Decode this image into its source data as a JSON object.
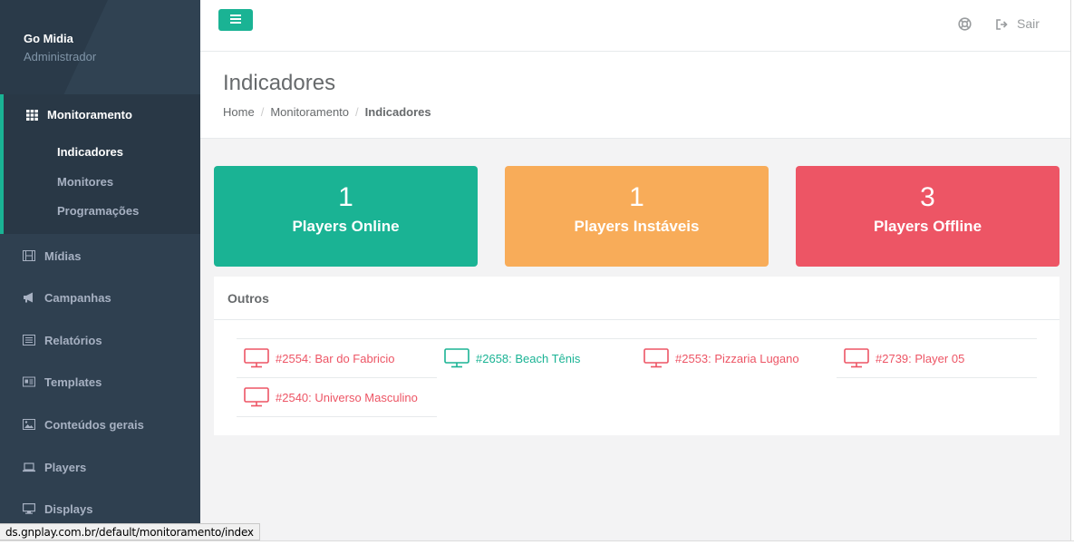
{
  "profile": {
    "name": "Go Midia",
    "role": "Administrador"
  },
  "sidebar": {
    "active_section": {
      "label": "Monitoramento",
      "icon": "grid-icon"
    },
    "sub_items": [
      {
        "label": "Indicadores",
        "active": true
      },
      {
        "label": "Monitores",
        "active": false
      },
      {
        "label": "Programações",
        "active": false
      }
    ],
    "items": [
      {
        "label": "Mídias",
        "icon": "film-icon"
      },
      {
        "label": "Campanhas",
        "icon": "bullhorn-icon"
      },
      {
        "label": "Relatórios",
        "icon": "list-alt-icon"
      },
      {
        "label": "Templates",
        "icon": "id-card-icon"
      },
      {
        "label": "Conteúdos gerais",
        "icon": "image-icon"
      },
      {
        "label": "Players",
        "icon": "laptop-icon"
      },
      {
        "label": "Displays",
        "icon": "desktop-icon"
      }
    ]
  },
  "topbar": {
    "menu_icon": "bars-icon",
    "help_icon": "life-ring-icon",
    "logout_label": "Sair",
    "logout_icon": "sign-out-icon"
  },
  "page": {
    "title": "Indicadores",
    "breadcrumb": [
      "Home",
      "Monitoramento",
      "Indicadores"
    ]
  },
  "widgets": [
    {
      "count": "1",
      "label": "Players Online",
      "color": "#1ab394"
    },
    {
      "count": "1",
      "label": "Players Instáveis",
      "color": "#f8ac59"
    },
    {
      "count": "3",
      "label": "Players Offline",
      "color": "#ed5565"
    }
  ],
  "panel": {
    "title": "Outros",
    "players": [
      {
        "label": "#2554: Bar do Fabricio",
        "status": "red"
      },
      {
        "label": "#2658: Beach Tênis",
        "status": "green"
      },
      {
        "label": "#2553: Pizzaria Lugano",
        "status": "red"
      },
      {
        "label": "#2739: Player 05",
        "status": "red"
      },
      {
        "label": "#2540: Universo Masculino",
        "status": "red"
      }
    ]
  },
  "statusbar": {
    "url": "ds.gnplay.com.br/default/monitoramento/index"
  },
  "colors": {
    "primary": "#1ab394",
    "warning": "#f8ac59",
    "danger": "#ed5565",
    "sidebar": "#2f4050"
  }
}
